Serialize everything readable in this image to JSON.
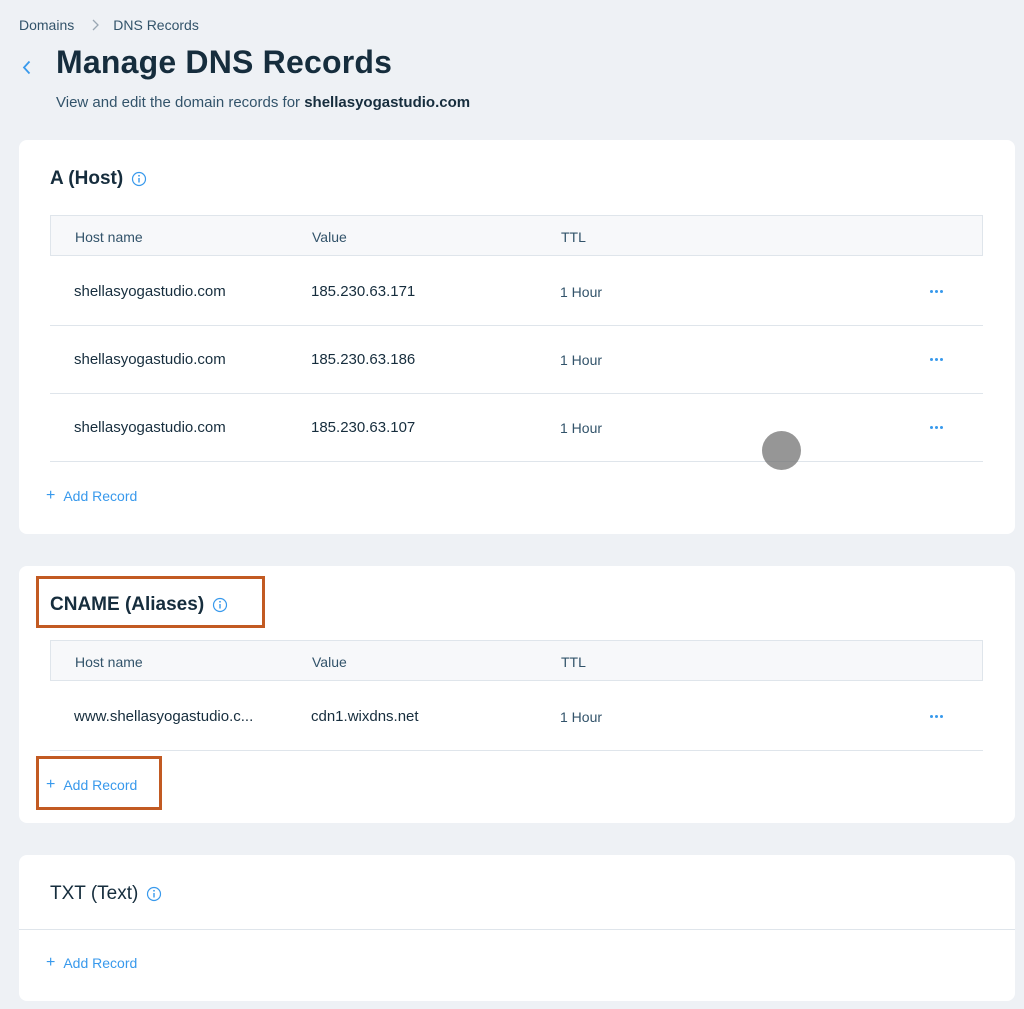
{
  "breadcrumb": {
    "items": [
      "Domains",
      "DNS Records"
    ]
  },
  "header": {
    "title": "Manage DNS Records",
    "subtitle_prefix": "View and edit the domain records for ",
    "domain": "shellasyogastudio.com"
  },
  "columns": {
    "host": "Host name",
    "value": "Value",
    "ttl": "TTL"
  },
  "a_records": {
    "title": "A (Host)",
    "rows": [
      {
        "host": "shellasyogastudio.com",
        "value": "185.230.63.171",
        "ttl": "1 Hour"
      },
      {
        "host": "shellasyogastudio.com",
        "value": "185.230.63.186",
        "ttl": "1 Hour"
      },
      {
        "host": "shellasyogastudio.com",
        "value": "185.230.63.107",
        "ttl": "1 Hour"
      }
    ],
    "add_label": "Add Record"
  },
  "cname_records": {
    "title": "CNAME (Aliases)",
    "rows": [
      {
        "host": "www.shellasyogastudio.c...",
        "value": "cdn1.wixdns.net",
        "ttl": "1 Hour"
      }
    ],
    "add_label": "Add Record"
  },
  "txt_records": {
    "title": "TXT (Text)",
    "add_label": "Add Record"
  },
  "colors": {
    "accent": "#3899ec",
    "highlight": "#c25a22",
    "background": "#eef1f5"
  }
}
